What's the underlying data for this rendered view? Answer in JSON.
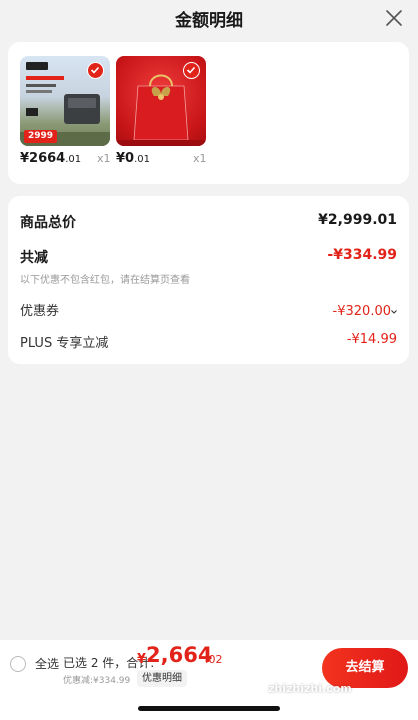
{
  "header": {
    "title": "金额明细"
  },
  "items": [
    {
      "price": "¥2664",
      "decimal": ".01",
      "qty": "x1",
      "badge": "2999"
    },
    {
      "price": "¥0",
      "decimal": ".01",
      "qty": "x1"
    }
  ],
  "summary": {
    "goods_total_label": "商品总价",
    "goods_total_value": "¥2,999.01",
    "reduction_label": "共减",
    "reduction_value": "-¥334.99",
    "reduction_note": "以下优惠不包含红包，请在结算页查看",
    "coupon_label": "优惠券",
    "coupon_value": "-¥320.00",
    "plus_label": "PLUS 专享立减",
    "plus_value": "-¥14.99"
  },
  "footer": {
    "select_all": "全选",
    "selected_text": "已选 2 件，合计:",
    "total_currency": "¥",
    "total_int": "2,664",
    "total_dec": ".02",
    "discount_text": "优惠减:¥334.99",
    "discount_detail_btn": "优惠明细",
    "checkout_label": "去结算",
    "watermark": "zhizhizhi.com"
  },
  "colors": {
    "accent": "#e2231a",
    "background": "#f2f2f2"
  }
}
